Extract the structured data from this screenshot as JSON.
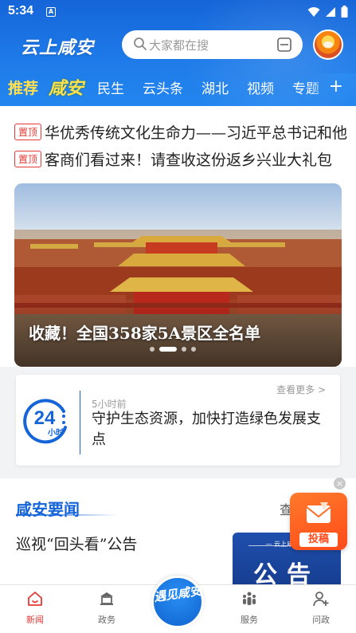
{
  "status_bar": {
    "time": "5:34",
    "a_icon": "A"
  },
  "header": {
    "logo": "云上咸安",
    "search_placeholder": "大家都在搜"
  },
  "tabs": [
    {
      "label": "推荐"
    },
    {
      "label": "咸安"
    },
    {
      "label": "民生"
    },
    {
      "label": "云头条"
    },
    {
      "label": "湖北"
    },
    {
      "label": "视频"
    },
    {
      "label": "专题"
    }
  ],
  "tab_add": "+",
  "pinned": [
    {
      "badge": "置顶",
      "title": "华优秀传统文化生命力——习近平总书记和他"
    },
    {
      "badge": "置顶",
      "title": "客商们看过来！请查收这份返乡兴业大礼包"
    }
  ],
  "banner": {
    "caption": "收藏！全国358家5A景区全名单",
    "slide_count": 4,
    "active_index": 1
  },
  "news24": {
    "icon_number": "24",
    "icon_unit": "小时",
    "more": "查看更多 >",
    "time": "5小时前",
    "title": "守护生态资源，加快打造绿色发展支点"
  },
  "section": {
    "title": "咸安要闻",
    "more": "查看",
    "article_title": "巡视“回头看”公告",
    "thumb_small": "— 云上咸安 —",
    "thumb_text": "公告"
  },
  "fab": {
    "label": "投稿",
    "close": "×"
  },
  "bottom_nav": {
    "items": [
      {
        "label": "新闻",
        "icon": "home-icon"
      },
      {
        "label": "政务",
        "icon": "government-icon"
      },
      {
        "label": "服务",
        "icon": "people-icon"
      },
      {
        "label": "问政",
        "icon": "add-user-icon"
      }
    ],
    "center_label": "遇见咸安"
  },
  "colors": {
    "brand_blue": "#1e7ae8",
    "accent_red": "#e53935",
    "tab_yellow": "#ffe04f",
    "fab_orange": "#ff5a1f"
  }
}
